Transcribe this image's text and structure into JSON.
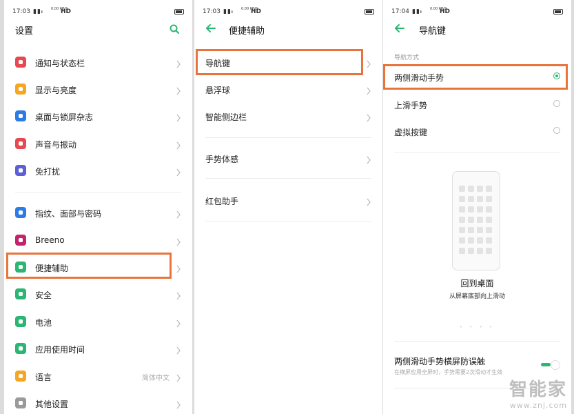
{
  "accent": "#2bb673",
  "highlight": "#e8743b",
  "panel1": {
    "status": {
      "time": "17:03",
      "net": "0.00 KB/S",
      "hd": "HD"
    },
    "title": "设置",
    "search_icon": "search-icon",
    "items": [
      {
        "label": "通知与状态栏",
        "color": "#e8484f"
      },
      {
        "label": "显示与亮度",
        "color": "#f5a623"
      },
      {
        "label": "桌面与锁屏杂志",
        "color": "#2d7be5"
      },
      {
        "label": "声音与振动",
        "color": "#e8484f"
      },
      {
        "label": "免打扰",
        "color": "#5c5fd6"
      },
      {
        "label": "指纹、面部与密码",
        "color": "#2d7be5"
      },
      {
        "label": "Breeno",
        "color": "#c0266d"
      },
      {
        "label": "便捷辅助",
        "color": "#2bb673"
      },
      {
        "label": "安全",
        "color": "#2bb673"
      },
      {
        "label": "电池",
        "color": "#2bb673"
      },
      {
        "label": "应用使用时间",
        "color": "#2bb673"
      },
      {
        "label": "语言",
        "color": "#f5a623",
        "value": "简体中文"
      },
      {
        "label": "其他设置",
        "color": "#9a9a9a"
      }
    ]
  },
  "panel2": {
    "status": {
      "time": "17:03",
      "net": "0.00 KB/S",
      "hd": "HD"
    },
    "title": "便捷辅助",
    "items": [
      {
        "label": "导航键"
      },
      {
        "label": "悬浮球"
      },
      {
        "label": "智能侧边栏"
      },
      {
        "label": "手势体感"
      },
      {
        "label": "红包助手"
      }
    ]
  },
  "panel3": {
    "status": {
      "time": "17:04",
      "net": "0.00 KB/S",
      "hd": "HD"
    },
    "title": "导航键",
    "section": "导航方式",
    "options": [
      {
        "label": "两侧滑动手势",
        "selected": true
      },
      {
        "label": "上滑手势",
        "selected": false
      },
      {
        "label": "虚拟按键",
        "selected": false
      }
    ],
    "preview_title": "回到桌面",
    "preview_sub": "从屏幕底部向上滑动",
    "pager": "• • • •",
    "toggle_label": "两侧滑动手势横屏防误触",
    "toggle_desc": "在横屏应用全屏时，手势需要2次滑动才生效",
    "toggle_on": true
  },
  "watermark": {
    "main": "智能家",
    "sub": "www.znj.com"
  }
}
